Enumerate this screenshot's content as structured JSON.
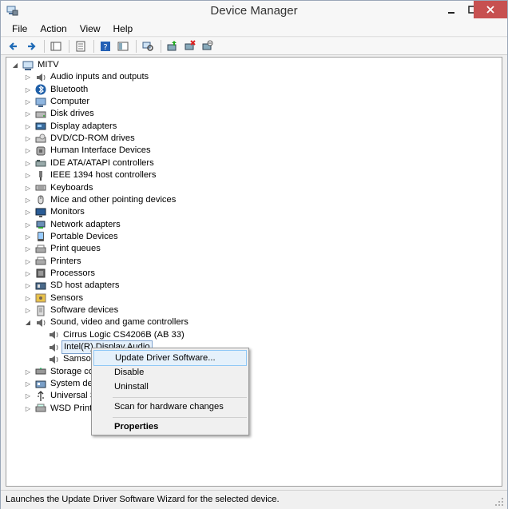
{
  "window": {
    "title": "Device Manager"
  },
  "menu": [
    "File",
    "Action",
    "View",
    "Help"
  ],
  "toolbar": [
    {
      "icon": "back-arrow-icon"
    },
    {
      "icon": "forward-arrow-icon"
    },
    {
      "sep": true
    },
    {
      "icon": "show-hide-console-tree-icon"
    },
    {
      "sep": true
    },
    {
      "icon": "properties-icon"
    },
    {
      "sep": true
    },
    {
      "icon": "help-icon"
    },
    {
      "icon": "console-tree-icon"
    },
    {
      "sep": true
    },
    {
      "icon": "scan-hardware-icon"
    },
    {
      "sep": true
    },
    {
      "icon": "update-driver-icon"
    },
    {
      "icon": "uninstall-icon"
    },
    {
      "icon": "disable-device-icon"
    }
  ],
  "tree": {
    "root": "MITV",
    "categories": [
      {
        "label": "Audio inputs and outputs",
        "icon": "speaker-icon"
      },
      {
        "label": "Bluetooth",
        "icon": "bluetooth-icon"
      },
      {
        "label": "Computer",
        "icon": "computer-icon"
      },
      {
        "label": "Disk drives",
        "icon": "disk-drive-icon"
      },
      {
        "label": "Display adapters",
        "icon": "display-adapter-icon"
      },
      {
        "label": "DVD/CD-ROM drives",
        "icon": "dvd-drive-icon"
      },
      {
        "label": "Human Interface Devices",
        "icon": "hid-icon"
      },
      {
        "label": "IDE ATA/ATAPI controllers",
        "icon": "ide-controller-icon"
      },
      {
        "label": "IEEE 1394 host controllers",
        "icon": "ieee1394-icon"
      },
      {
        "label": "Keyboards",
        "icon": "keyboard-icon"
      },
      {
        "label": "Mice and other pointing devices",
        "icon": "mouse-icon"
      },
      {
        "label": "Monitors",
        "icon": "monitor-icon"
      },
      {
        "label": "Network adapters",
        "icon": "network-adapter-icon"
      },
      {
        "label": "Portable Devices",
        "icon": "portable-device-icon"
      },
      {
        "label": "Print queues",
        "icon": "printer-icon"
      },
      {
        "label": "Printers",
        "icon": "printer-icon"
      },
      {
        "label": "Processors",
        "icon": "processor-icon"
      },
      {
        "label": "SD host adapters",
        "icon": "sd-adapter-icon"
      },
      {
        "label": "Sensors",
        "icon": "sensor-icon"
      },
      {
        "label": "Software devices",
        "icon": "software-device-icon"
      },
      {
        "label": "Sound, video and game controllers",
        "icon": "speaker-icon",
        "expanded": true,
        "children": [
          "Cirrus Logic CS4206B (AB 33)",
          "Intel(R) Display Audio",
          "Samson"
        ]
      },
      {
        "label": "Storage con",
        "icon": "storage-controller-icon"
      },
      {
        "label": "System devi",
        "icon": "system-device-icon"
      },
      {
        "label": "Universal Se",
        "icon": "usb-icon"
      },
      {
        "label": "WSD Print P",
        "icon": "wsd-printer-icon"
      }
    ],
    "selected_child": "Intel(R) Display Audio"
  },
  "context_menu": {
    "items": [
      "Update Driver Software...",
      "Disable",
      "Uninstall",
      "Scan for hardware changes",
      "Properties"
    ]
  },
  "status": {
    "text": "Launches the Update Driver Software Wizard for the selected device."
  },
  "colors": {
    "close": "#c75050",
    "selection": "#e5f0fb",
    "selection_border": "#7da2ce",
    "ctx_highlight": "#e5f1fb"
  }
}
